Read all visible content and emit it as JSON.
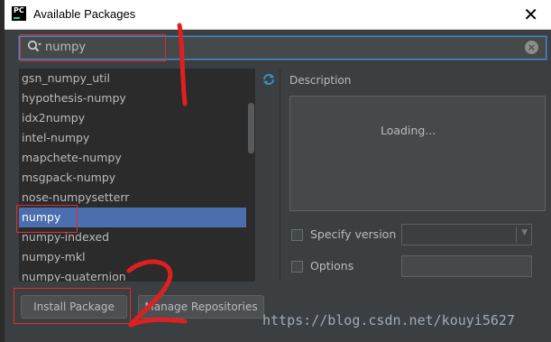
{
  "window": {
    "title": "Available Packages",
    "app_icon_text": "PC"
  },
  "search": {
    "value": "numpy"
  },
  "packages": [
    "gsn_numpy_util",
    "hypothesis-numpy",
    "idx2numpy",
    "intel-numpy",
    "mapchete-numpy",
    "msgpack-numpy",
    "nose-numpysetterr",
    "numpy",
    "numpy-indexed",
    "numpy-mkl",
    "numpy-quaternion"
  ],
  "selected_package": "numpy",
  "description": {
    "label": "Description",
    "status": "Loading..."
  },
  "options": {
    "specify_version_label": "Specify version",
    "options_label": "Options"
  },
  "buttons": {
    "install": "Install Package",
    "manage_repos": "Manage Repositories"
  },
  "watermark": "https://blog.csdn.net/kouyi5627",
  "annotations": {
    "marks": [
      "1",
      "2"
    ],
    "color": "#e02020"
  },
  "colors": {
    "selection": "#4b6eaf",
    "accent_border": "#4a88c7",
    "annotation_red": "#e62b2b"
  }
}
